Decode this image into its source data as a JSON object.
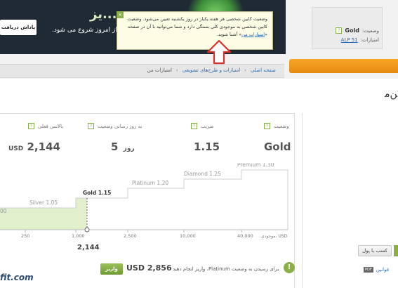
{
  "banner": {
    "button_label": "پاداش دریافت",
    "title": "...یز",
    "subtitle": "از امروز شروع می شود."
  },
  "account": {
    "status_label": "وضعیت:",
    "status_value": "Gold",
    "points_label": "امتیازات:",
    "points_value": "ALP 51"
  },
  "tooltip": {
    "close_label": "×",
    "text_before_link": "وضعیت کابین شخصی هر هفته یکبار در روز یکشنبه تعیین می‌شود. وضعیت کابین شخصی به موجودی کلی بستگی دارد و شما می‌توانید با آن در صفحه «",
    "link_text": "امتیازات من",
    "text_after_link": "» آشنا شوید."
  },
  "breadcrumb": {
    "home": "صفحه اصلی",
    "sep1": "›",
    "section": "امتیازات و طرح‌های تشویقی",
    "sep2": "›",
    "current": "امتیازات من"
  },
  "page": {
    "title": "ﻦﻣ"
  },
  "stats": {
    "status": {
      "label": "وضعیت",
      "value": "Gold",
      "help": "?"
    },
    "multiplier": {
      "label": "ضریب",
      "value": "1.15",
      "help": "?"
    },
    "update": {
      "label": "به روز رسانی وضعیت",
      "value": "5",
      "unit": "روز",
      "help": "?"
    },
    "balance": {
      "label": "بالانس فعلی",
      "value": "2,144",
      "unit": "USD",
      "help": "?"
    }
  },
  "chart_data": {
    "type": "step",
    "levels": [
      {
        "name": "Silver",
        "multiplier": "1.05",
        "from": 250
      },
      {
        "name": "Gold",
        "multiplier": "1.15",
        "from": 1000
      },
      {
        "name": "Platinum",
        "multiplier": "1.20",
        "from": 2500
      },
      {
        "name": "Diamond",
        "multiplier": "1.25",
        "from": 10000
      },
      {
        "name": "Premium",
        "multiplier": "1.30",
        "from": 40000
      }
    ],
    "edge_label": "00",
    "x_ticks": [
      "250",
      "1,000",
      "2,500",
      "10,000",
      "40,000"
    ],
    "x_axis_label": "موجودی، USD",
    "current_value": "2,144",
    "current_level": "Gold",
    "colors": {
      "achieved": "#e2efcd",
      "line": "#cfcfcf",
      "marker": "#666666"
    }
  },
  "bottom": {
    "info_icon": "!",
    "note": "برای رسیدن به وضعیت Platinum، واریز انجام دهید",
    "amount": "USD 2,856",
    "deposit_label": "واریز",
    "logo_fragment": "fit.com"
  },
  "side": {
    "earn_button": "کسب با پول",
    "laws_label": "قوانین",
    "pdf_label": "PDF"
  }
}
